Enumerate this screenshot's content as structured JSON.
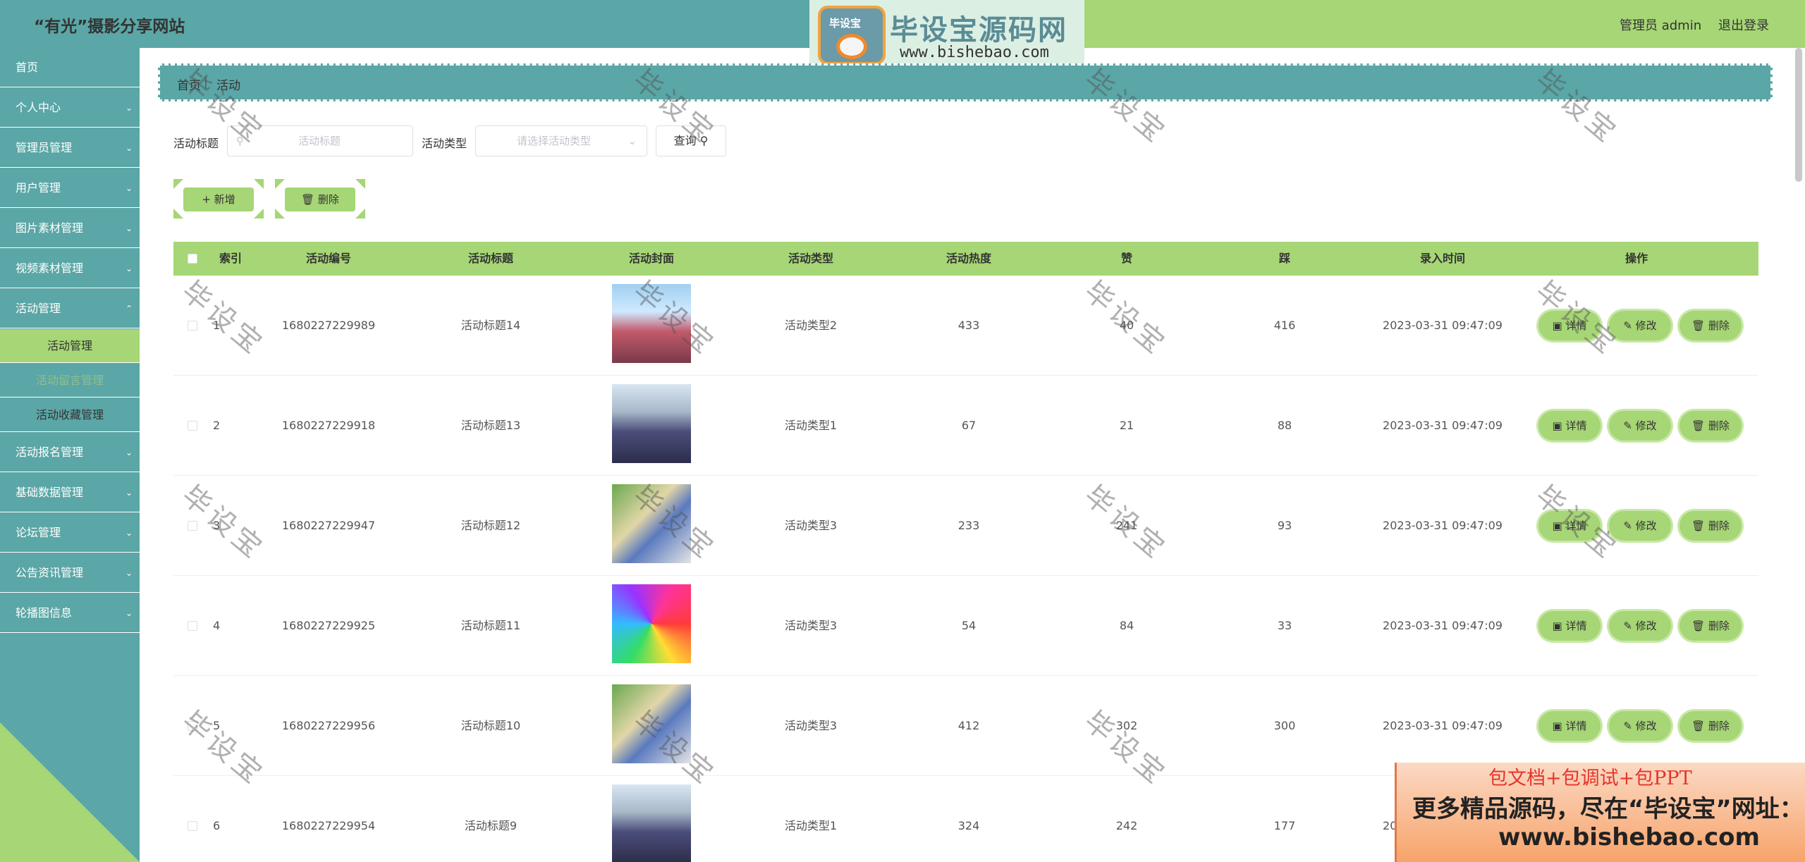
{
  "header": {
    "site_title": "“有光”摄影分享网站",
    "admin_label": "管理员 admin",
    "logout_label": "退出登录"
  },
  "logo": {
    "badge_text": "毕设宝",
    "title": "毕设宝源码网",
    "url": "www.bishebao.com"
  },
  "sidebar": {
    "items": [
      {
        "label": "首页",
        "chevron": false
      },
      {
        "label": "个人中心",
        "chevron": true
      },
      {
        "label": "管理员管理",
        "chevron": true
      },
      {
        "label": "用户管理",
        "chevron": true
      },
      {
        "label": "图片素材管理",
        "chevron": true
      },
      {
        "label": "视频素材管理",
        "chevron": true
      },
      {
        "label": "活动管理",
        "chevron": true,
        "expanded": true
      }
    ],
    "subitems": [
      {
        "label": "活动管理",
        "active": true
      },
      {
        "label": "活动留言管理",
        "active": false
      },
      {
        "label": "活动收藏管理",
        "active": false
      }
    ],
    "items_after": [
      {
        "label": "活动报名管理"
      },
      {
        "label": "基础数据管理"
      },
      {
        "label": "论坛管理"
      },
      {
        "label": "公告资讯管理"
      },
      {
        "label": "轮播图信息"
      }
    ]
  },
  "breadcrumb": {
    "home": "首页",
    "current": "活动"
  },
  "search": {
    "title_label": "活动标题",
    "title_placeholder": "活动标题",
    "type_label": "活动类型",
    "type_placeholder": "请选择活动类型",
    "query_label": "查询"
  },
  "actions": {
    "add_label": "+ 新增",
    "delete_label": "删除"
  },
  "table": {
    "headers": [
      "索引",
      "活动编号",
      "活动标题",
      "活动封面",
      "活动类型",
      "活动热度",
      "赞",
      "踩",
      "录入时间",
      "操作"
    ],
    "row_actions": {
      "detail": "详情",
      "edit": "修改",
      "delete": "删除"
    },
    "rows": [
      {
        "index": "1",
        "no": "1680227229989",
        "title": "活动标题14",
        "type": "活动类型2",
        "heat": "433",
        "like": "40",
        "dislike": "416",
        "time": "2023-03-31 09:47:09"
      },
      {
        "index": "2",
        "no": "1680227229918",
        "title": "活动标题13",
        "type": "活动类型1",
        "heat": "67",
        "like": "21",
        "dislike": "88",
        "time": "2023-03-31 09:47:09"
      },
      {
        "index": "3",
        "no": "1680227229947",
        "title": "活动标题12",
        "type": "活动类型3",
        "heat": "233",
        "like": "241",
        "dislike": "93",
        "time": "2023-03-31 09:47:09"
      },
      {
        "index": "4",
        "no": "1680227229925",
        "title": "活动标题11",
        "type": "活动类型3",
        "heat": "54",
        "like": "84",
        "dislike": "33",
        "time": "2023-03-31 09:47:09"
      },
      {
        "index": "5",
        "no": "1680227229956",
        "title": "活动标题10",
        "type": "活动类型3",
        "heat": "412",
        "like": "302",
        "dislike": "300",
        "time": "2023-03-31 09:47:09"
      },
      {
        "index": "6",
        "no": "1680227229954",
        "title": "活动标题9",
        "type": "活动类型1",
        "heat": "324",
        "like": "242",
        "dislike": "177",
        "time": "2023-03-31 09:47:09"
      }
    ]
  },
  "watermark": "毕设宝",
  "promo": {
    "line1": "包文档+包调试+包PPT",
    "line2": "更多精品源码，尽在“毕设宝”网址：",
    "line3": "www.bishebao.com"
  },
  "colors": {
    "teal": "#5ba6a6",
    "green": "#a6d675"
  }
}
